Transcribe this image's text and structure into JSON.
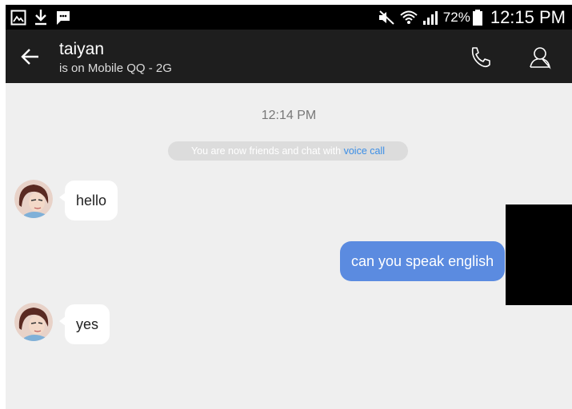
{
  "status_bar": {
    "left_icons": [
      "gallery-icon",
      "download-icon",
      "message-icon"
    ],
    "right_icons": [
      "mute-icon",
      "wifi-icon",
      "signal-icon"
    ],
    "battery": "72%",
    "time": "12:15 PM"
  },
  "header": {
    "contact_name": "taiyan",
    "status": "is on Mobile QQ - 2G",
    "icons": [
      "back-arrow-icon",
      "phone-icon",
      "profile-icon"
    ]
  },
  "chat": {
    "timestamp": "12:14 PM",
    "notice_text": "You are now friends and chat with",
    "notice_link": "voice call",
    "messages": [
      {
        "from": "contact",
        "text": "hello"
      },
      {
        "from": "me",
        "text": "can you speak english"
      },
      {
        "from": "contact",
        "text": "yes"
      }
    ]
  },
  "colors": {
    "header_bg": "#1e1e1e",
    "chat_bg": "#efefef",
    "outgoing_bubble": "#5b8be0",
    "incoming_bubble": "#ffffff",
    "link": "#3b8ee6"
  }
}
